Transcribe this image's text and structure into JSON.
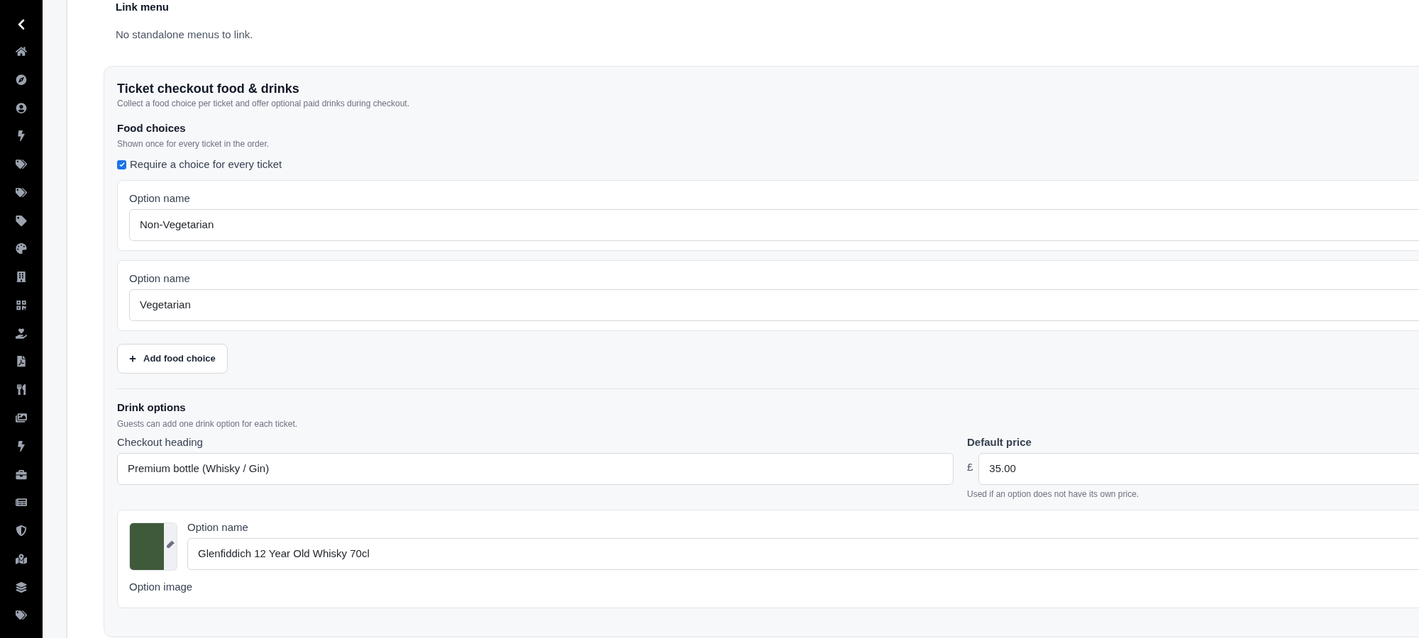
{
  "link_menu": {
    "title": "Link menu",
    "message": "No standalone menus to link."
  },
  "card": {
    "title": "Ticket checkout food & drinks",
    "subtitle": "Collect a food choice per ticket and offer optional paid drinks during checkout.",
    "food": {
      "title": "Food choices",
      "description": "Shown once for every ticket in the order.",
      "require": {
        "label": "Require a choice for every ticket",
        "checked": true
      },
      "options": [
        {
          "label": "Option name",
          "value": "Non-Vegetarian"
        },
        {
          "label": "Option name",
          "value": "Vegetarian"
        }
      ],
      "add_button": "Add food choice"
    },
    "drinks": {
      "title": "Drink options",
      "description": "Guests can add one drink option for each ticket.",
      "heading_field": {
        "label": "Checkout heading",
        "value": "Premium bottle (Whisky / Gin)"
      },
      "price_field": {
        "label": "Default price",
        "currency": "£",
        "value": "35.00",
        "hint": "Used if an option does not have its own price."
      },
      "options": [
        {
          "label": "Option name",
          "value": "Glenfiddich 12 Year Old Whisky 70cl",
          "image_label": "Option image"
        }
      ]
    }
  }
}
